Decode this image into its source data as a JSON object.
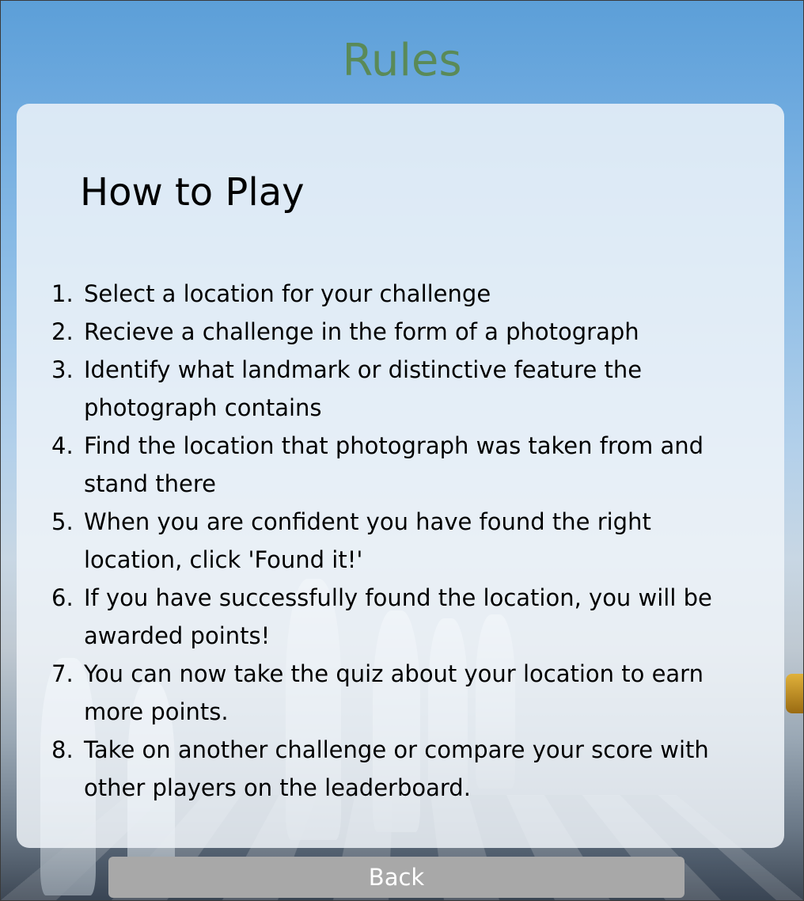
{
  "page": {
    "title": "Rules"
  },
  "card": {
    "heading": "How to Play",
    "rules": [
      {
        "num": "1.",
        "text": "Select a location for your challenge"
      },
      {
        "num": "2.",
        "text": "Recieve a challenge in the form of a photograph"
      },
      {
        "num": "3.",
        "text": "Identify what landmark or distinctive feature the photograph contains"
      },
      {
        "num": "4.",
        "text": "Find the location that photograph was taken from and stand there"
      },
      {
        "num": "5.",
        "text": "When you are confident you have found the right location, click 'Found it!'"
      },
      {
        "num": "6.",
        "text": "If you have successfully found the location, you will be awarded points!"
      },
      {
        "num": "7.",
        "text": "You can now take the quiz about your location to earn more points."
      },
      {
        "num": "8.",
        "text": "Take on another challenge or compare your score with other players on the leaderboard."
      }
    ]
  },
  "actions": {
    "back_label": "Back"
  },
  "colors": {
    "title": "#5a8a58",
    "card_background": "rgba(240,244,249,0.84)",
    "button_background": "#a8a8a8",
    "button_text": "#ffffff"
  },
  "background": {
    "icon": "chess-pieces-background"
  }
}
